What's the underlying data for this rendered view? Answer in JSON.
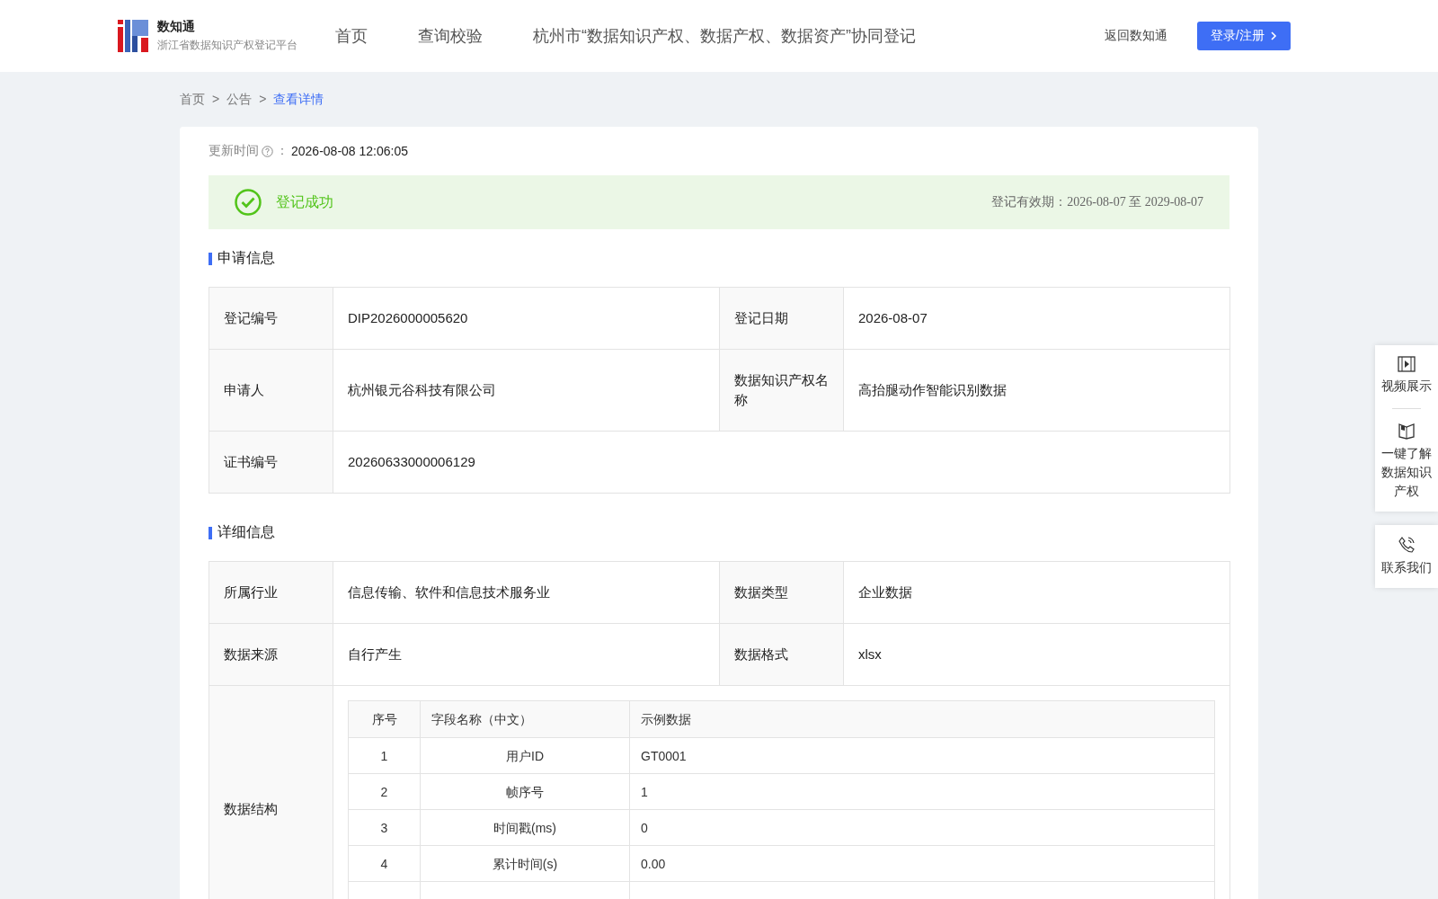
{
  "header": {
    "brand": "数知通",
    "subtitle": "浙江省数据知识产权登记平台",
    "nav": [
      {
        "label": "首页",
        "selected": false
      },
      {
        "label": "查询校验",
        "selected": false
      },
      {
        "label": "杭州市“数据知识产权、数据产权、数据资产”协同登记",
        "selected": false
      }
    ],
    "back_link": "返回数知通",
    "login_button": "登录/注册"
  },
  "breadcrumb": [
    {
      "label": "首页",
      "selected": false
    },
    {
      "label": "公告",
      "selected": false
    },
    {
      "label": "查看详情",
      "selected": true
    }
  ],
  "breadcrumb_separator": ">",
  "update_time": {
    "label": "更新时间",
    "separator": "：",
    "value": "2026-08-08 12:06:05"
  },
  "status_banner": {
    "success": true,
    "text": "登记成功",
    "validity": "登记有效期：2026-08-07 至 2029-08-07"
  },
  "application_info": {
    "title": "申请信息",
    "rows": [
      [
        {
          "label": "登记编号",
          "value": "DIP2026000005620"
        },
        {
          "label": "登记日期",
          "value": "2026-08-07"
        }
      ],
      [
        {
          "label": "申请人",
          "value": "杭州银元谷科技有限公司"
        },
        {
          "label": "数据知识产权名称",
          "value": "高抬腿动作智能识别数据"
        }
      ],
      [
        {
          "label": "证书编号",
          "value": "20260633000006129"
        }
      ]
    ]
  },
  "detail_info": {
    "title": "详细信息",
    "rows": [
      [
        {
          "label": "所属行业",
          "value": "信息传输、软件和信息技术服务业"
        },
        {
          "label": "数据类型",
          "value": "企业数据"
        }
      ],
      [
        {
          "label": "数据来源",
          "value": "自行产生"
        },
        {
          "label": "数据格式",
          "value": "xlsx"
        }
      ]
    ],
    "structure": {
      "label": "数据结构",
      "columns": [
        "序号",
        "字段名称（中文）",
        "示例数据"
      ],
      "rows": [
        [
          "1",
          "用户ID",
          "GT0001"
        ],
        [
          "2",
          "帧序号",
          "1"
        ],
        [
          "3",
          "时间戳(ms)",
          "0"
        ],
        [
          "4",
          "累计时间(s)",
          "0.00"
        ]
      ]
    }
  },
  "side_menu": [
    {
      "kind": "video",
      "label": "视频展示"
    },
    {
      "kind": "book",
      "label": "一键了解数据知识产权"
    },
    {
      "kind": "phone",
      "label": "联系我们"
    }
  ]
}
